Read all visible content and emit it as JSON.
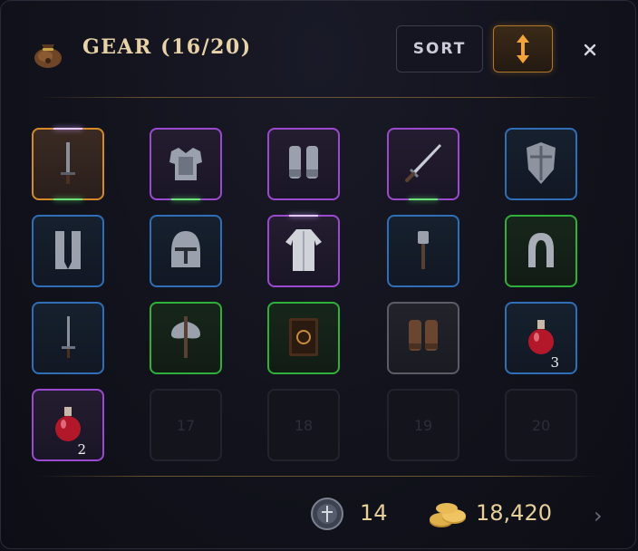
{
  "header": {
    "title": "GEAR (16/20)",
    "sort_label": "SORT",
    "icons": {
      "bag": "loot-bag-icon",
      "order": "sort-order-icon",
      "close": "close-icon"
    }
  },
  "colors": {
    "legendary": "#d58a2a",
    "epic": "#9b4ad0",
    "rare": "#2e6fb8",
    "uncommon": "#2fb03a",
    "common": "#5a5c66",
    "gold_text": "#e8cf9a"
  },
  "inventory": {
    "used": 16,
    "capacity": 20,
    "slots": [
      {
        "item": "dagger",
        "quality": "legendary",
        "qty": "",
        "label": ""
      },
      {
        "item": "chest-armor",
        "quality": "epic",
        "qty": "",
        "label": ""
      },
      {
        "item": "gauntlets",
        "quality": "epic",
        "qty": "",
        "label": ""
      },
      {
        "item": "sword",
        "quality": "epic",
        "qty": "",
        "label": ""
      },
      {
        "item": "shield",
        "quality": "rare",
        "qty": "",
        "label": ""
      },
      {
        "item": "greaves",
        "quality": "rare",
        "qty": "",
        "label": ""
      },
      {
        "item": "helmet",
        "quality": "rare",
        "qty": "",
        "label": ""
      },
      {
        "item": "robe",
        "quality": "epic",
        "qty": "",
        "label": ""
      },
      {
        "item": "mace",
        "quality": "rare",
        "qty": "",
        "label": ""
      },
      {
        "item": "horseshoe",
        "quality": "uncommon",
        "qty": "",
        "label": ""
      },
      {
        "item": "short-sword",
        "quality": "rare",
        "qty": "",
        "label": ""
      },
      {
        "item": "battle-axe",
        "quality": "uncommon",
        "qty": "",
        "label": ""
      },
      {
        "item": "spellbook",
        "quality": "uncommon",
        "qty": "",
        "label": ""
      },
      {
        "item": "leather-gloves",
        "quality": "common",
        "qty": "",
        "label": ""
      },
      {
        "item": "health-potion",
        "quality": "rare",
        "qty": "3",
        "label": ""
      },
      {
        "item": "health-potion",
        "quality": "epic",
        "qty": "2",
        "label": ""
      },
      {
        "item": "empty",
        "quality": "empty",
        "qty": "",
        "label": "17"
      },
      {
        "item": "empty",
        "quality": "empty",
        "qty": "",
        "label": "18"
      },
      {
        "item": "empty",
        "quality": "empty",
        "qty": "",
        "label": "19"
      },
      {
        "item": "empty",
        "quality": "empty",
        "qty": "",
        "label": "20"
      }
    ]
  },
  "footer": {
    "token_count": "14",
    "gold": "18,420",
    "icons": {
      "token": "token-coin-icon",
      "gold": "gold-coins-icon",
      "next": "chevron-right-icon"
    },
    "next_label": "›"
  }
}
